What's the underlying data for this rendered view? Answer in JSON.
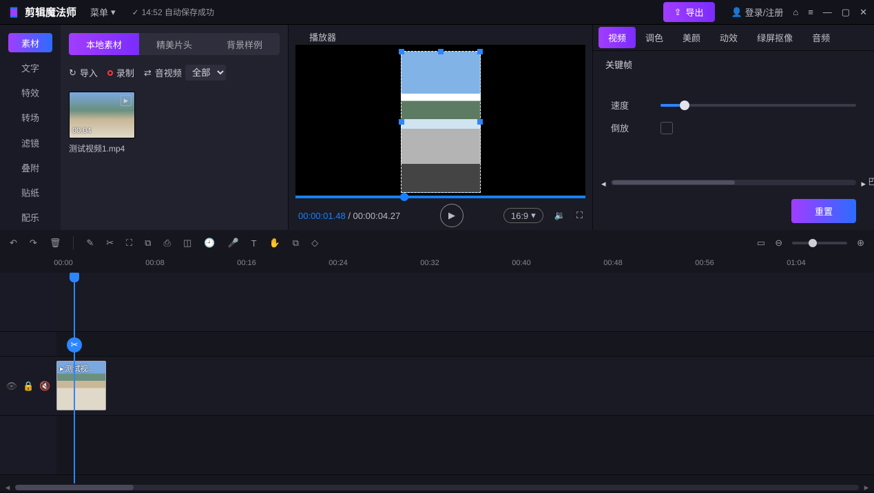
{
  "titlebar": {
    "app_name": "剪辑魔法师",
    "menu_label": "菜单",
    "autosave_text": "14:52 自动保存成功",
    "export_label": "导出",
    "login_label": "登录/注册"
  },
  "leftnav": {
    "items": [
      {
        "label": "素材"
      },
      {
        "label": "文字"
      },
      {
        "label": "特效"
      },
      {
        "label": "转场"
      },
      {
        "label": "滤镜"
      },
      {
        "label": "叠附"
      },
      {
        "label": "贴纸"
      },
      {
        "label": "配乐"
      }
    ]
  },
  "media": {
    "tabs": [
      {
        "label": "本地素材"
      },
      {
        "label": "精美片头"
      },
      {
        "label": "背景样例"
      }
    ],
    "import_label": "导入",
    "record_label": "录制",
    "avtype_label": "音视频",
    "filter_value": "全部",
    "items": [
      {
        "name": "测试视频1.mp4",
        "duration": "00:04"
      }
    ]
  },
  "player": {
    "title": "播放器",
    "current_tc": "00:00:01.48",
    "total_tc": "00:00:04.27",
    "aspect_label": "16:9"
  },
  "props": {
    "tabs": [
      {
        "label": "视频"
      },
      {
        "label": "调色"
      },
      {
        "label": "美颜"
      },
      {
        "label": "动效"
      },
      {
        "label": "绿屏抠像"
      },
      {
        "label": "音频"
      }
    ],
    "subsection": "关键帧",
    "speed_label": "速度",
    "reverse_label": "倒放",
    "reset_label": "重置"
  },
  "timeline": {
    "ticks": [
      "00:00",
      "00:08",
      "00:16",
      "00:24",
      "00:32",
      "00:40",
      "00:48",
      "00:56",
      "01:04"
    ],
    "clip_label": "测试视..."
  }
}
